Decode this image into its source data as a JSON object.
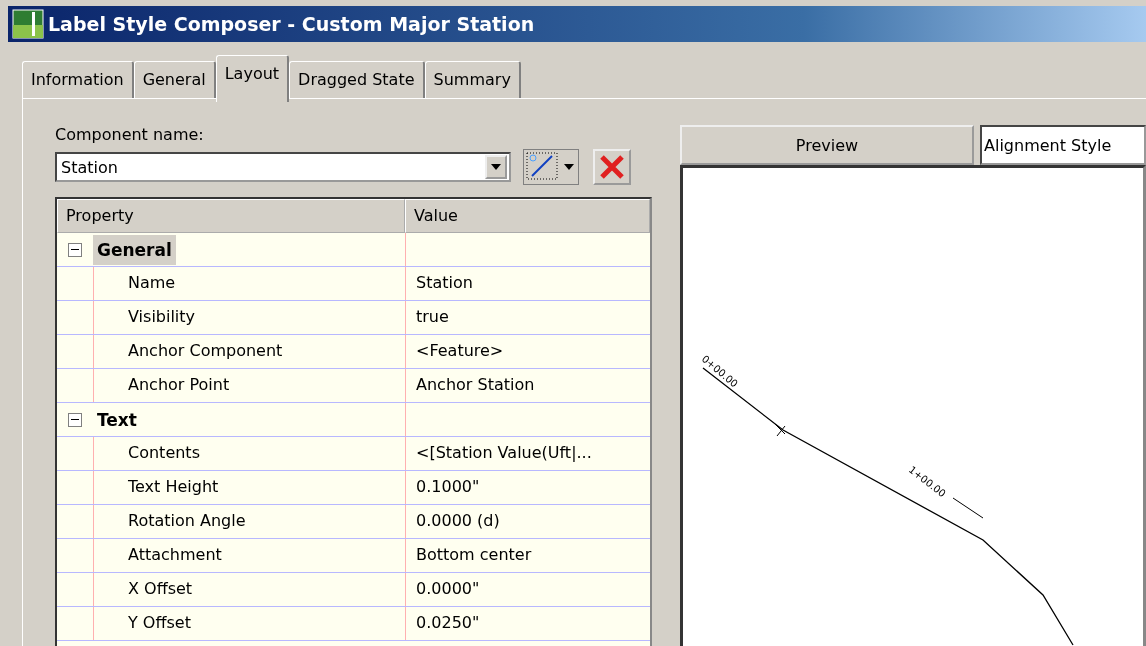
{
  "window": {
    "title": "Label Style Composer - Custom Major Station"
  },
  "tabs": [
    {
      "label": "Information",
      "selected": false
    },
    {
      "label": "General",
      "selected": false
    },
    {
      "label": "Layout",
      "selected": true
    },
    {
      "label": "Dragged State",
      "selected": false
    },
    {
      "label": "Summary",
      "selected": false
    }
  ],
  "component": {
    "label": "Component name:",
    "value": "Station"
  },
  "grid": {
    "columns": [
      "Property",
      "Value"
    ],
    "groups": [
      {
        "label": "General",
        "expanded": true,
        "selected": true,
        "children": [
          {
            "property": "Name",
            "value": "Station"
          },
          {
            "property": "Visibility",
            "value": "true"
          },
          {
            "property": "Anchor Component",
            "value": "<Feature>"
          },
          {
            "property": "Anchor Point",
            "value": "Anchor Station"
          }
        ]
      },
      {
        "label": "Text",
        "expanded": true,
        "selected": false,
        "children": [
          {
            "property": "Contents",
            "value": "<[Station Value(Uft|..."
          },
          {
            "property": "Text Height",
            "value": "0.1000\""
          },
          {
            "property": "Rotation Angle",
            "value": "0.0000 (d)"
          },
          {
            "property": "Attachment",
            "value": "Bottom center"
          },
          {
            "property": "X Offset",
            "value": "0.0000\""
          },
          {
            "property": "Y Offset",
            "value": "0.0250\""
          }
        ]
      }
    ]
  },
  "preview": {
    "label": "Preview",
    "style": "Alignment Style",
    "station_labels": [
      "0+00.00",
      "1+00.00"
    ]
  }
}
